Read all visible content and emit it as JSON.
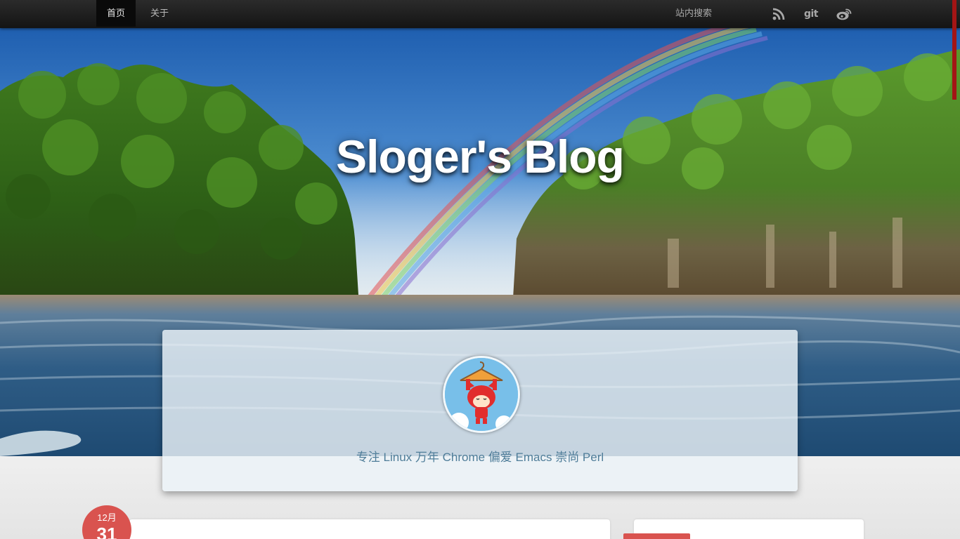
{
  "navbar": {
    "items": [
      {
        "label": "首页"
      },
      {
        "label": "关于"
      }
    ],
    "search_placeholder": "站内搜索",
    "icons": [
      "rss-icon",
      "git-icon",
      "weibo-icon"
    ],
    "git_label": "git"
  },
  "hero": {
    "title": "Sloger's Blog"
  },
  "profile": {
    "tagline": "专注 Linux 万年 Chrome 偏爱 Emacs 崇尚 Perl"
  },
  "post": {
    "month": "12月",
    "day": "31"
  },
  "colors": {
    "accent": "#d9534f",
    "navbar": "#1b1b1b",
    "tagline": "#4f7d99"
  }
}
